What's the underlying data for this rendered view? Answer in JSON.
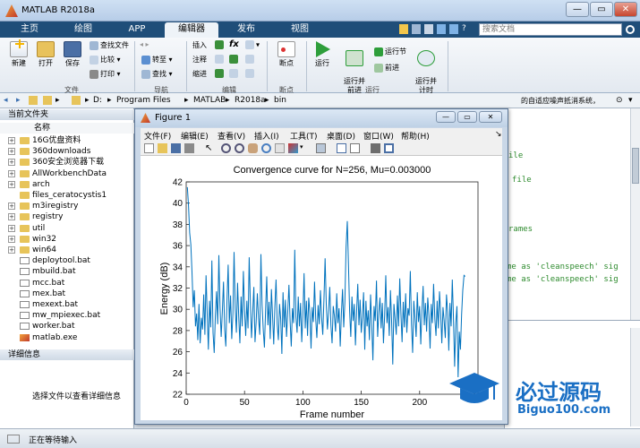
{
  "app": {
    "title": "MATLAB R2018a",
    "window_buttons": [
      "—",
      "▭",
      "✕"
    ],
    "tabs": [
      "主页",
      "绘图",
      "APP",
      "编辑器",
      "发布",
      "视图"
    ],
    "search_placeholder": "搜索文档"
  },
  "ribbon": {
    "file_group": {
      "label": "文件",
      "new": "新建",
      "open": "打开",
      "save": "保存",
      "find_files": "查找文件",
      "compare": "比较",
      "print": "打印"
    },
    "nav_group": {
      "label": "导航",
      "goto": "转至",
      "find": "查找"
    },
    "edit_group": {
      "label": "编辑",
      "insert": "插入",
      "comment": "注释",
      "indent": "缩进",
      "fx": "fx"
    },
    "breakpoints_group": {
      "label": "断点",
      "breakpoints": "断点"
    },
    "run_group": {
      "label": "运行",
      "run": "运行",
      "run_advance": "运行并\n前进",
      "run_section": "运行节",
      "advance": "前进",
      "run_time": "运行并\n计时"
    }
  },
  "address": {
    "crumbs": [
      "D:",
      "Program Files",
      "MATLAB",
      "R2018a",
      "bin"
    ],
    "right_text": "的自适应噪声抵消系统，"
  },
  "left_panel": {
    "header": "当前文件夹",
    "column": "名称",
    "items": [
      {
        "name": "16G优盘资料",
        "type": "folder",
        "expand": true
      },
      {
        "name": "360downloads",
        "type": "folder",
        "expand": true
      },
      {
        "name": "360安全浏览器下载",
        "type": "folder",
        "expand": true
      },
      {
        "name": "AllWorkbenchData",
        "type": "folder",
        "expand": true
      },
      {
        "name": "arch",
        "type": "folder",
        "expand": true
      },
      {
        "name": "files_ceratocystis1",
        "type": "folder",
        "expand": false
      },
      {
        "name": "m3iregistry",
        "type": "folder",
        "expand": true
      },
      {
        "name": "registry",
        "type": "folder",
        "expand": true
      },
      {
        "name": "util",
        "type": "folder",
        "expand": true
      },
      {
        "name": "win32",
        "type": "folder",
        "expand": true
      },
      {
        "name": "win64",
        "type": "folder",
        "expand": true
      },
      {
        "name": "deploytool.bat",
        "type": "file",
        "expand": false
      },
      {
        "name": "mbuild.bat",
        "type": "file",
        "expand": false
      },
      {
        "name": "mcc.bat",
        "type": "file",
        "expand": false
      },
      {
        "name": "mex.bat",
        "type": "file",
        "expand": false
      },
      {
        "name": "mexext.bat",
        "type": "file",
        "expand": false
      },
      {
        "name": "mw_mpiexec.bat",
        "type": "file",
        "expand": false
      },
      {
        "name": "worker.bat",
        "type": "file",
        "expand": false
      },
      {
        "name": "matlab.exe",
        "type": "exe",
        "expand": false
      }
    ],
    "details_header": "详细信息",
    "details_text": "选择文件以查看详细信息"
  },
  "editor": {
    "lines": [
      {
        "text": "ile",
        "row": 0
      },
      {
        "text": "file",
        "row": 1
      },
      {
        "text": "rames",
        "row": 2
      },
      {
        "text": "me as 'cleanspeech' sig",
        "row": 3
      },
      {
        "text": "me as 'cleanspeech' sig",
        "row": 4
      }
    ]
  },
  "status": {
    "text": "正在等待输入"
  },
  "figure": {
    "title": "Figure 1",
    "menu": [
      "文件(F)",
      "编辑(E)",
      "查看(V)",
      "插入(I)",
      "工具(T)",
      "桌面(D)",
      "窗口(W)",
      "帮助(H)"
    ]
  },
  "watermark": {
    "big": "必过源码",
    "small": "Biguo100.com"
  },
  "colors": {
    "line": "#0072bd",
    "ribbon_tab_bg": "#1f4e79",
    "run_icon": "#2e9e3b"
  },
  "chart_data": {
    "type": "line",
    "title": "Convergence curve for N=256, Mu=0.003000",
    "xlabel": "Frame number",
    "ylabel": "Energy (dB)",
    "xlim": [
      0,
      250
    ],
    "ylim": [
      22,
      42
    ],
    "xticks": [
      0,
      50,
      100,
      150,
      200
    ],
    "yticks": [
      22,
      24,
      26,
      28,
      30,
      32,
      34,
      36,
      38,
      40,
      42
    ],
    "series": [
      {
        "x_start": 1,
        "values": [
          41.5,
          39.8,
          37.2,
          36.1,
          33.5,
          30.2,
          31.8,
          28.4,
          29.6,
          27.1,
          30.5,
          26.8,
          29.2,
          28.1,
          31.4,
          27.6,
          33.2,
          29.5,
          26.2,
          30.8,
          28.3,
          34.6,
          27.8,
          25.9,
          29.4,
          31.7,
          28.6,
          35.1,
          30.2,
          27.4,
          29.8,
          32.6,
          28.1,
          26.5,
          30.9,
          34.2,
          28.7,
          31.3,
          27.2,
          29.6,
          35.4,
          30.1,
          27.8,
          32.5,
          29.3,
          26.8,
          31.2,
          28.4,
          33.6,
          29.9,
          27.5,
          30.8,
          28.2,
          34.9,
          30.6,
          27.3,
          29.7,
          32.1,
          26.9,
          28.8,
          31.5,
          29.2,
          27.6,
          35.2,
          30.4,
          28.1,
          26.4,
          29.9,
          33.1,
          28.5,
          30.7,
          27.2,
          31.9,
          29.4,
          26.7,
          30.3,
          32.8,
          28.6,
          27.1,
          30.5,
          29.1,
          25.8,
          31.6,
          28.3,
          30.9,
          27.4,
          29.6,
          32.3,
          28.9,
          26.5,
          30.1,
          28.7,
          35.6,
          29.3,
          27.8,
          31.2,
          28.4,
          30.6,
          26.9,
          29.5,
          33.4,
          28.2,
          30.8,
          27.5,
          31.1,
          29.7,
          26.3,
          30.2,
          28.8,
          32.6,
          29.1,
          27.3,
          30.4,
          28.6,
          31.8,
          29.2,
          27.6,
          30.9,
          34.8,
          30.5,
          28.1,
          29.8,
          32.1,
          28.5,
          26.8,
          30.3,
          29.4,
          27.9,
          31.5,
          28.7,
          30.1,
          26.5,
          29.6,
          31.9,
          28.3,
          30.7,
          35.8,
          38.3,
          34.2,
          29.8,
          27.4,
          31.2,
          28.9,
          30.5,
          26.6,
          29.8,
          32.4,
          28.5,
          30.9,
          27.8,
          29.3,
          31.6,
          26.2,
          30.8,
          28.4,
          29.9,
          27.1,
          31.4,
          28.6,
          25.2,
          30.3,
          28.9,
          32.7,
          27.4,
          29.7,
          31.1,
          28.2,
          30.6,
          26.8,
          29.4,
          33.2,
          28.7,
          30.2,
          27.5,
          31.8,
          28.9,
          24.8,
          30.5,
          29.1,
          27.6,
          31.3,
          28.4,
          32.9,
          29.6,
          26.9,
          30.7,
          28.3,
          31.5,
          27.8,
          30.1,
          29.4,
          33.6,
          28.6,
          25.9,
          30.8,
          29.2,
          27.4,
          31.6,
          28.8,
          30.3,
          26.7,
          29.9,
          32.2,
          28.5,
          30.6,
          27.9,
          31.1,
          29.4,
          26.3,
          30.5,
          28.7,
          32.4,
          29.1,
          27.5,
          30.8,
          28.2,
          31.7,
          29.6,
          26.8,
          30.2,
          28.9,
          27.3,
          31.4,
          29.8,
          26.1,
          30.6,
          28.4,
          32.8,
          29.2,
          24.6,
          28.7,
          30.3,
          23.6,
          27.9,
          26.2,
          29.5,
          31.8,
          33.2,
          33.1
        ]
      }
    ]
  }
}
